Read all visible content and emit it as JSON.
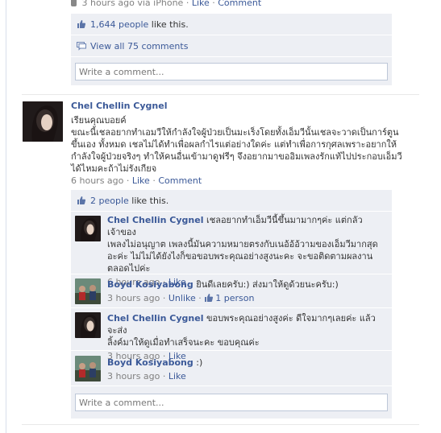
{
  "top_post": {
    "meta_time": "3 hours ago via iPhone",
    "like_link": "Like",
    "comment_link": "Comment",
    "likes_count": "1,644 people",
    "likes_suffix": "like this.",
    "view_all": "View all 75 comments",
    "write_placeholder": "Write a comment..."
  },
  "post": {
    "author": "Chel Chellin Cygnel",
    "text_lines": [
      "เรียนคุณบอยค์",
      "ขณะนี้เชลอยากทำเอมวีให้กำลังใจผู้ป่วยเป็นมะเร็งโดยทั้งเอ็มวีนั้นเชลจะวาดเป็นการ์ตูน",
      "ขึ้นเอง ทั้งหมด เชลไม่ได้ทำเพื่อผลกำไรแต่อย่างใดค่ะ แต่ทำเพื่อการกุศลเพราะอยากให้",
      "กำลังใจผู้ป่วยจริงๆ ทำให้คนอื่นเข้ามาดูฟรีๆ จึงอยากมาขออิมเพลงรักแท้ไปประกอบเอ็มวี",
      "ได้ไหมคะถ้าไม่รังเกียจ"
    ],
    "time": "6 hours ago",
    "like_link": "Like",
    "comment_link": "Comment",
    "likes_count": "2 people",
    "likes_suffix": "like this."
  },
  "comments": [
    {
      "author": "Chel Chellin Cygnel",
      "lines": [
        " เชลอยากทำเอ็มวีนี้ขึ้นมามากๆค่ะ แต่กลัวเจ้าของ",
        "เพลงไม่อนุญาต เพลงนี้มันความหมายตรงกับเนอ้อ้อ้วามของเอ็มวีมากสุด",
        "อะค่ะ ไม่ไม่ได้ยังไงก็ขอขอบพระคุณอย่างสูงนะคะ จะขอติดตามผลงาน",
        "ตลอดไปค่ะ"
      ],
      "time": "6 hours ago",
      "like_link": "Like",
      "unlike_link": "",
      "person_count": ""
    },
    {
      "author": "Boyd Kosiyabong",
      "lines": [
        " ยินดีเลยครับ:) ส่งมาให้ดูด้วยนะครับ:)"
      ],
      "time": "3 hours ago",
      "like_link": "",
      "unlike_link": "Unlike",
      "person_count": "1 person"
    },
    {
      "author": "Chel Chellin Cygnel",
      "lines": [
        " ขอบพระคุณอย่างสูงค่ะ ดีใจมากๆเลยค่ะ แล้วจะส่ง",
        "ลิ้งค์มาให้ดูเมื่อทำเสร็จนะคะ ขอบคุณค่ะ"
      ],
      "time": "3 hours ago",
      "like_link": "Like",
      "unlike_link": "",
      "person_count": ""
    },
    {
      "author": "Boyd Kosiyabong",
      "lines": [
        " :)"
      ],
      "time": "3 hours ago",
      "like_link": "Like",
      "unlike_link": "",
      "person_count": ""
    }
  ],
  "bottom_write_placeholder": "Write a comment...",
  "colors": {
    "link": "#3b5998",
    "ufi_bg": "#edeff4",
    "border": "#bdc7d8"
  },
  "icons": [
    "iphone-icon",
    "thumbs-up-icon",
    "comments-icon"
  ]
}
